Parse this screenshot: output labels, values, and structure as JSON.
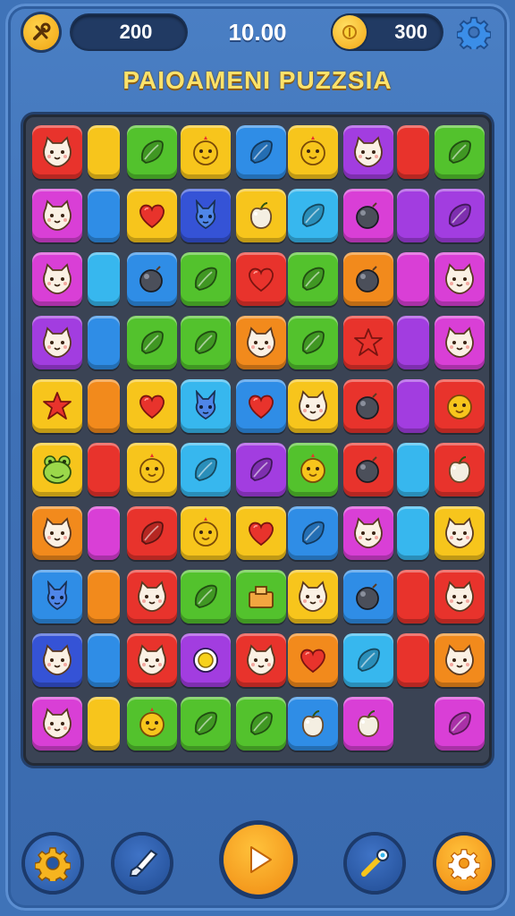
{
  "hud": {
    "coins_left": "200",
    "timer": "10.00",
    "coins_right": "300",
    "title": "PAIOAMENI PUZZSIA"
  },
  "colors": {
    "red": "#e8332c",
    "yellow": "#f7c51c",
    "green": "#53c22d",
    "blue": "#2f8de6",
    "purple": "#a23de0",
    "magenta": "#d93fd6",
    "orange": "#f28a1c",
    "navy": "#3553d6",
    "cyan": "#37b7ee"
  },
  "board": {
    "rows": [
      [
        {
          "c": "red",
          "i": "cat-face"
        },
        {
          "c": "yellow",
          "i": "blank",
          "slim": true
        },
        {
          "c": "green",
          "i": "leaf"
        },
        {
          "c": "yellow",
          "i": "chick-face"
        },
        {
          "c": "blue",
          "i": "leaf"
        },
        {
          "c": "yellow",
          "i": "chick-face"
        },
        {
          "c": "purple",
          "i": "cat-face"
        },
        {
          "c": "red",
          "i": "blank",
          "slim": true
        },
        {
          "c": "green",
          "i": "leaf"
        }
      ],
      [
        {
          "c": "magenta",
          "i": "cat-face"
        },
        {
          "c": "blue",
          "i": "blank",
          "slim": true
        },
        {
          "c": "yellow",
          "i": "heart"
        },
        {
          "c": "navy",
          "i": "bunny-face"
        },
        {
          "c": "yellow",
          "i": "apple"
        },
        {
          "c": "cyan",
          "i": "leaf"
        },
        {
          "c": "magenta",
          "i": "bomb"
        },
        {
          "c": "purple",
          "i": "blank",
          "slim": true
        },
        {
          "c": "purple",
          "i": "leaf"
        }
      ],
      [
        {
          "c": "magenta",
          "i": "cat-face"
        },
        {
          "c": "cyan",
          "i": "blank",
          "slim": true
        },
        {
          "c": "blue",
          "i": "bomb"
        },
        {
          "c": "green",
          "i": "leaf"
        },
        {
          "c": "red",
          "i": "heart"
        },
        {
          "c": "green",
          "i": "leaf"
        },
        {
          "c": "orange",
          "i": "bomb"
        },
        {
          "c": "magenta",
          "i": "blank",
          "slim": true
        },
        {
          "c": "magenta",
          "i": "cat-face"
        }
      ],
      [
        {
          "c": "purple",
          "i": "cat-face"
        },
        {
          "c": "blue",
          "i": "blank",
          "slim": true
        },
        {
          "c": "green",
          "i": "leaf"
        },
        {
          "c": "green",
          "i": "leaf"
        },
        {
          "c": "orange",
          "i": "cat-face"
        },
        {
          "c": "green",
          "i": "leaf"
        },
        {
          "c": "red",
          "i": "star"
        },
        {
          "c": "purple",
          "i": "blank",
          "slim": true
        },
        {
          "c": "magenta",
          "i": "cat-face"
        }
      ],
      [
        {
          "c": "yellow",
          "i": "star"
        },
        {
          "c": "orange",
          "i": "blank",
          "slim": true
        },
        {
          "c": "yellow",
          "i": "heart"
        },
        {
          "c": "cyan",
          "i": "bunny-face"
        },
        {
          "c": "blue",
          "i": "heart"
        },
        {
          "c": "yellow",
          "i": "cat-face"
        },
        {
          "c": "red",
          "i": "bomb"
        },
        {
          "c": "purple",
          "i": "blank",
          "slim": true
        },
        {
          "c": "red",
          "i": "chick-face"
        }
      ],
      [
        {
          "c": "yellow",
          "i": "frog-face"
        },
        {
          "c": "red",
          "i": "blank",
          "slim": true
        },
        {
          "c": "yellow",
          "i": "chick-face"
        },
        {
          "c": "cyan",
          "i": "leaf"
        },
        {
          "c": "purple",
          "i": "leaf"
        },
        {
          "c": "green",
          "i": "chick-face"
        },
        {
          "c": "red",
          "i": "bomb"
        },
        {
          "c": "cyan",
          "i": "blank",
          "slim": true
        },
        {
          "c": "red",
          "i": "apple"
        }
      ],
      [
        {
          "c": "orange",
          "i": "cat-face"
        },
        {
          "c": "magenta",
          "i": "blank",
          "slim": true
        },
        {
          "c": "red",
          "i": "leaf"
        },
        {
          "c": "yellow",
          "i": "chick-face"
        },
        {
          "c": "yellow",
          "i": "heart"
        },
        {
          "c": "blue",
          "i": "leaf"
        },
        {
          "c": "magenta",
          "i": "cat-face"
        },
        {
          "c": "cyan",
          "i": "blank",
          "slim": true
        },
        {
          "c": "yellow",
          "i": "cat-face"
        }
      ],
      [
        {
          "c": "blue",
          "i": "bunny-face"
        },
        {
          "c": "orange",
          "i": "blank",
          "slim": true
        },
        {
          "c": "red",
          "i": "cat-face"
        },
        {
          "c": "green",
          "i": "leaf"
        },
        {
          "c": "green",
          "i": "box"
        },
        {
          "c": "yellow",
          "i": "cat-face"
        },
        {
          "c": "blue",
          "i": "bomb"
        },
        {
          "c": "red",
          "i": "blank",
          "slim": true
        },
        {
          "c": "red",
          "i": "cat-face"
        }
      ],
      [
        {
          "c": "navy",
          "i": "cat-face"
        },
        {
          "c": "blue",
          "i": "blank",
          "slim": true
        },
        {
          "c": "red",
          "i": "cat-face"
        },
        {
          "c": "purple",
          "i": "ring"
        },
        {
          "c": "red",
          "i": "cat-face"
        },
        {
          "c": "orange",
          "i": "heart"
        },
        {
          "c": "cyan",
          "i": "leaf"
        },
        {
          "c": "red",
          "i": "blank",
          "slim": true
        },
        {
          "c": "orange",
          "i": "cat-face"
        }
      ],
      [
        {
          "c": "magenta",
          "i": "cat-face"
        },
        {
          "c": "yellow",
          "i": "blank",
          "slim": true
        },
        {
          "c": "green",
          "i": "chick-face"
        },
        {
          "c": "green",
          "i": "leaf"
        },
        {
          "c": "green",
          "i": "leaf"
        },
        {
          "c": "blue",
          "i": "apple"
        },
        {
          "c": "magenta",
          "i": "apple"
        },
        {
          "c": "none",
          "i": "empty",
          "slim": true
        },
        {
          "c": "magenta",
          "i": "leaf"
        }
      ]
    ]
  },
  "buttons": {
    "top_left": "tools-icon",
    "coin": "coin-icon",
    "settings": "gear-icon",
    "bottom": [
      "sun-gear-icon",
      "brush-icon",
      "play-icon",
      "wand-icon",
      "gear-icon"
    ]
  }
}
